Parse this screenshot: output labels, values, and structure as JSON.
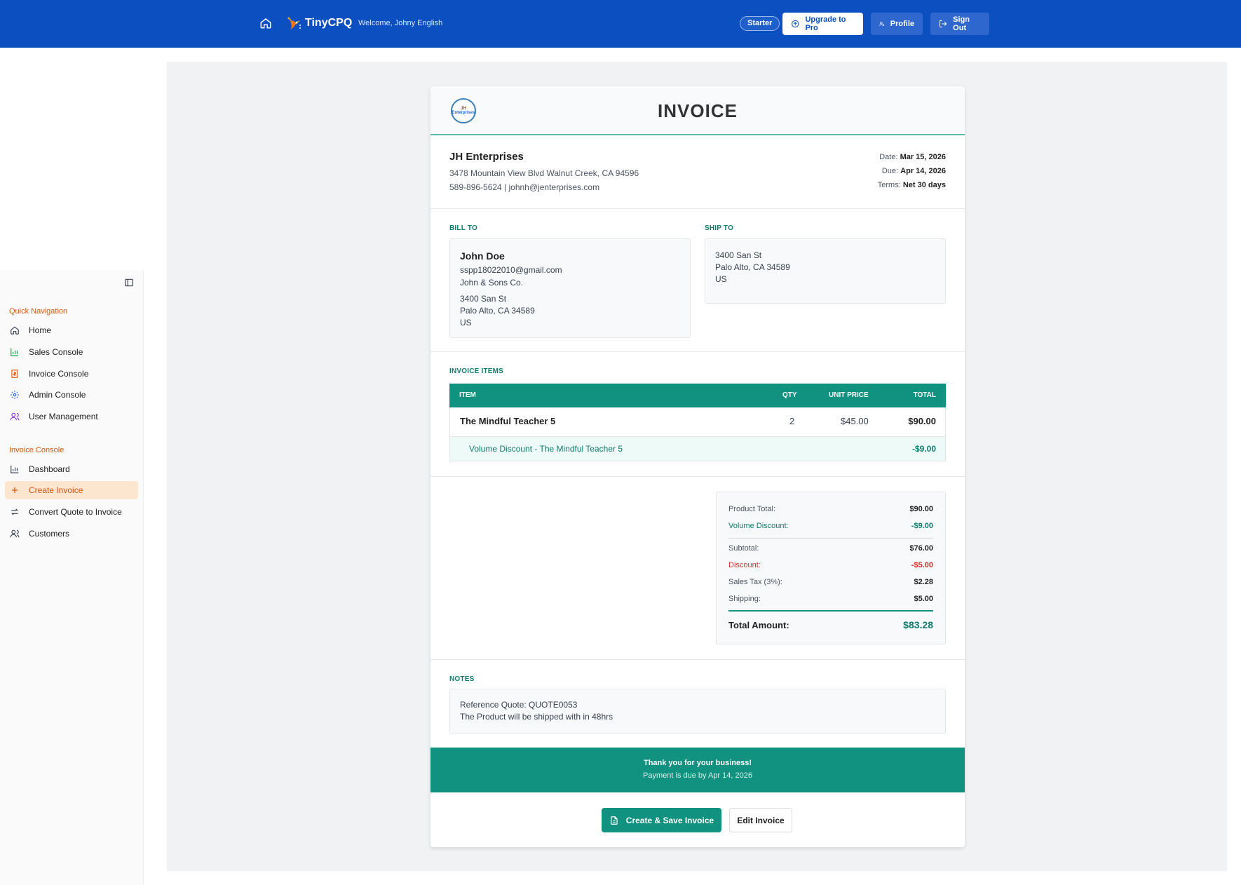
{
  "topbar": {
    "brand": "TinyCPQ",
    "welcome": "Welcome, Johny English",
    "plan_badge": "Starter",
    "upgrade_label": "Upgrade to Pro",
    "profile_label": "Profile",
    "signout_label": "Sign Out",
    "bg_color": "#0b4fc0"
  },
  "sidebar": {
    "quick_nav_title": "Quick Navigation",
    "quick_nav": [
      {
        "label": "Home",
        "icon": "home-icon"
      },
      {
        "label": "Sales Console",
        "icon": "bar-chart-icon"
      },
      {
        "label": "Invoice Console",
        "icon": "invoice-icon"
      },
      {
        "label": "Admin Console",
        "icon": "gear-icon"
      },
      {
        "label": "User Management",
        "icon": "users-icon"
      }
    ],
    "invoice_console_title": "Invoice Console",
    "invoice_console": [
      {
        "label": "Dashboard",
        "icon": "bar-chart-icon"
      },
      {
        "label": "Create Invoice",
        "icon": "plus-icon",
        "active": true
      },
      {
        "label": "Convert Quote to Invoice",
        "icon": "swap-icon"
      },
      {
        "label": "Customers",
        "icon": "users-icon"
      }
    ],
    "accent_color": "#d4570f"
  },
  "invoice": {
    "title": "INVOICE",
    "logo_text": [
      "JH",
      "Enterprises"
    ],
    "company": {
      "name": "JH Enterprises",
      "address": "3478 Mountain View Blvd Walnut Creek, CA 94596",
      "contact": "589-896-5624 | johnh@jenterprises.com"
    },
    "meta": {
      "date_label": "Date:",
      "date": "Mar 15, 2026",
      "due_label": "Due:",
      "due": "Apr 14, 2026",
      "terms_label": "Terms:",
      "terms": "Net 30 days"
    },
    "bill_to": {
      "label": "BILL TO",
      "name": "John Doe",
      "email": "sspp18022010@gmail.com",
      "company": "John & Sons Co.",
      "street": "3400 San St",
      "city": "Palo Alto, CA 34589",
      "country": "US"
    },
    "ship_to": {
      "label": "SHIP TO",
      "street": "3400 San St",
      "city": "Palo Alto, CA 34589",
      "country": "US"
    },
    "items": {
      "label": "INVOICE ITEMS",
      "columns": {
        "item": "ITEM",
        "qty": "QTY",
        "unit_price": "UNIT PRICE",
        "total": "TOTAL"
      },
      "rows": [
        {
          "item": "The Mindful Teacher 5",
          "qty": "2",
          "unit_price": "$45.00",
          "total": "$90.00"
        }
      ],
      "discount_row": {
        "label": "Volume Discount - The Mindful Teacher 5",
        "amount": "-$9.00"
      }
    },
    "totals": {
      "product_total_label": "Product Total:",
      "product_total": "$90.00",
      "volume_discount_label": "Volume Discount:",
      "volume_discount": "-$9.00",
      "subtotal_label": "Subtotal:",
      "subtotal": "$76.00",
      "discount_label": "Discount:",
      "discount": "-$5.00",
      "tax_label": "Sales Tax (3%):",
      "tax": "$2.28",
      "shipping_label": "Shipping:",
      "shipping": "$5.00",
      "total_label": "Total Amount:",
      "total": "$83.28"
    },
    "notes": {
      "label": "NOTES",
      "line1": "Reference Quote: QUOTE0053",
      "line2": "The Product will be shipped with in 48hrs"
    },
    "footer": {
      "thanks": "Thank you for your business!",
      "due_note": "Payment is due by Apr 14, 2026"
    },
    "actions": {
      "create_label": "Create & Save Invoice",
      "edit_label": "Edit Invoice"
    },
    "accent_color": "#11917f"
  }
}
